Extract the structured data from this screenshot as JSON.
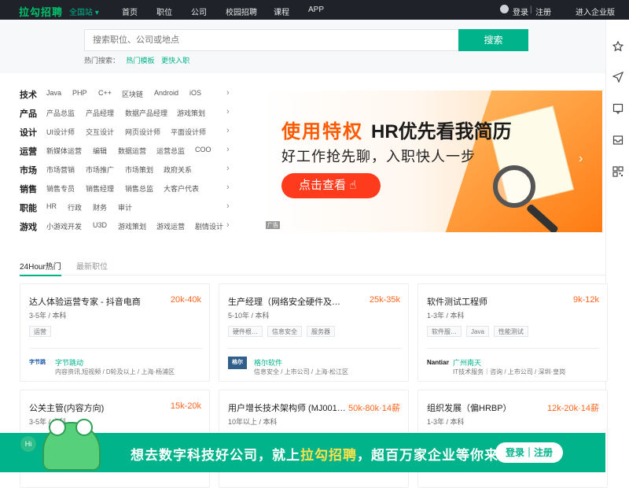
{
  "nav": {
    "logo": "拉勾招聘",
    "city": "全国站",
    "links": [
      "首页",
      "职位",
      "公司",
      "校园招聘",
      "课程",
      "APP"
    ],
    "login": "登录",
    "separator": "|",
    "register": "注册",
    "enterprise": "进入企业版"
  },
  "search": {
    "placeholder": "搜索职位、公司或地点",
    "button": "搜索",
    "hot_label": "热门搜索：",
    "hot_tags": [
      "热门模板",
      "更快入职"
    ]
  },
  "categories": [
    {
      "name": "技术",
      "items": [
        "Java",
        "PHP",
        "C++",
        "区块链",
        "Android",
        "iOS"
      ]
    },
    {
      "name": "产品",
      "items": [
        "产品总监",
        "产品经理",
        "数据产品经理",
        "游戏策划"
      ]
    },
    {
      "name": "设计",
      "items": [
        "UI设计师",
        "交互设计",
        "网页设计师",
        "平面设计师"
      ]
    },
    {
      "name": "运营",
      "items": [
        "新媒体运营",
        "编辑",
        "数据运营",
        "运营总监",
        "COO"
      ]
    },
    {
      "name": "市场",
      "items": [
        "市场营销",
        "市场推广",
        "市场策划",
        "政府关系"
      ]
    },
    {
      "name": "销售",
      "items": [
        "销售专员",
        "销售经理",
        "销售总监",
        "大客户代表"
      ]
    },
    {
      "name": "职能",
      "items": [
        "HR",
        "行政",
        "财务",
        "审计"
      ]
    },
    {
      "name": "游戏",
      "items": [
        "小游戏开发",
        "U3D",
        "游戏策划",
        "游戏运营",
        "剧情设计"
      ]
    }
  ],
  "banner": {
    "headline_accent": "使用特权",
    "headline": "HR优先看我简历",
    "subline": "好工作抢先聊，入职快人一步",
    "cta": "点击查看",
    "ad_tag": "广告"
  },
  "tabs": [
    "24Hour热门",
    "最新职位"
  ],
  "jobs": [
    {
      "title": "达人体验运营专家 - 抖音电商",
      "salary": "20k-40k",
      "req": "3-5年 / 本科",
      "tags": [
        "运营"
      ],
      "logo": "字节跳动",
      "company": "字节跳动",
      "info": "内容资讯,短视频 / D轮及以上 / 上海·杨浦区"
    },
    {
      "title": "生产经理（网络安全硬件及…",
      "salary": "25k-35k",
      "req": "5-10年 / 本科",
      "tags": [
        "硬件根…",
        "信息安全",
        "服务器"
      ],
      "logo": "格尔",
      "company": "格尔软件",
      "info": "信息安全 / 上市公司 / 上海·松江区"
    },
    {
      "title": "软件测试工程师",
      "salary": "9k-12k",
      "req": "1-3年 / 本科",
      "tags": [
        "软件服…",
        "Java",
        "性能测试"
      ],
      "logo": "Nantian",
      "company": "广州南天",
      "info": "IT技术服务｜咨询 / 上市公司 / 深圳·皇岗"
    },
    {
      "title": "公关主管(内容方向)",
      "salary": "15k-20k",
      "req": "3-5年 / 本科",
      "tags": [],
      "logo": "",
      "company": "",
      "info": ""
    },
    {
      "title": "用户增长技术架构师 (MJ001…",
      "salary": "50k-80k·14薪",
      "req": "10年以上 / 本科",
      "tags": [],
      "logo": "",
      "company": "",
      "info": ""
    },
    {
      "title": "组织发展（偏HRBP）",
      "salary": "12k-20k·14薪",
      "req": "1-3年 / 本科",
      "tags": [],
      "logo": "",
      "company": "",
      "info": ""
    }
  ],
  "footer": {
    "hi": "Hi",
    "slogan_pre": "想去数字科技好公司，就上",
    "slogan_hl": "拉勾招聘",
    "slogan_post": "，超百万家企业等你来",
    "button": "登录｜注册"
  },
  "colors": {
    "brand": "#00b38a",
    "salary": "#fd661f",
    "nav_bg": "#1f2329"
  }
}
